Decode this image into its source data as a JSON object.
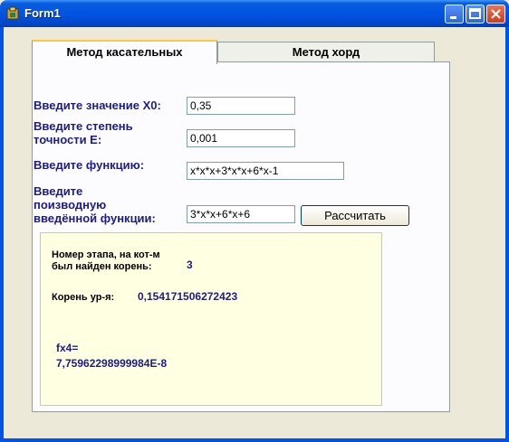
{
  "window": {
    "title": "Form1"
  },
  "tabs": [
    {
      "label": "Метод касательных",
      "active": true
    },
    {
      "label": "Метод хорд",
      "active": false
    }
  ],
  "form": {
    "x0_label": "Введите значение X0:",
    "x0_value": "0,35",
    "eps_label_line1": "Введите степень",
    "eps_label_line2": "точности E:",
    "eps_value": "0,001",
    "func_label": "Введите функцию:",
    "func_value": "x*x*x+3*x*x+6*x-1",
    "deriv_label_line1": "Введите",
    "deriv_label_line2": "поизводную",
    "deriv_label_line3": "введённой функции:",
    "deriv_value": "3*x*x+6*x+6",
    "calc_button": "Рассчитать"
  },
  "result": {
    "step_label_line1": "Номер этапа, на кот-м",
    "step_label_line2": "был найден корень:",
    "step_value": "3",
    "root_label": "Корень ур-я:",
    "root_value": "0,154171506272423",
    "fx_label": "fx4=",
    "fx_value": "7,75962298999984E-8"
  }
}
